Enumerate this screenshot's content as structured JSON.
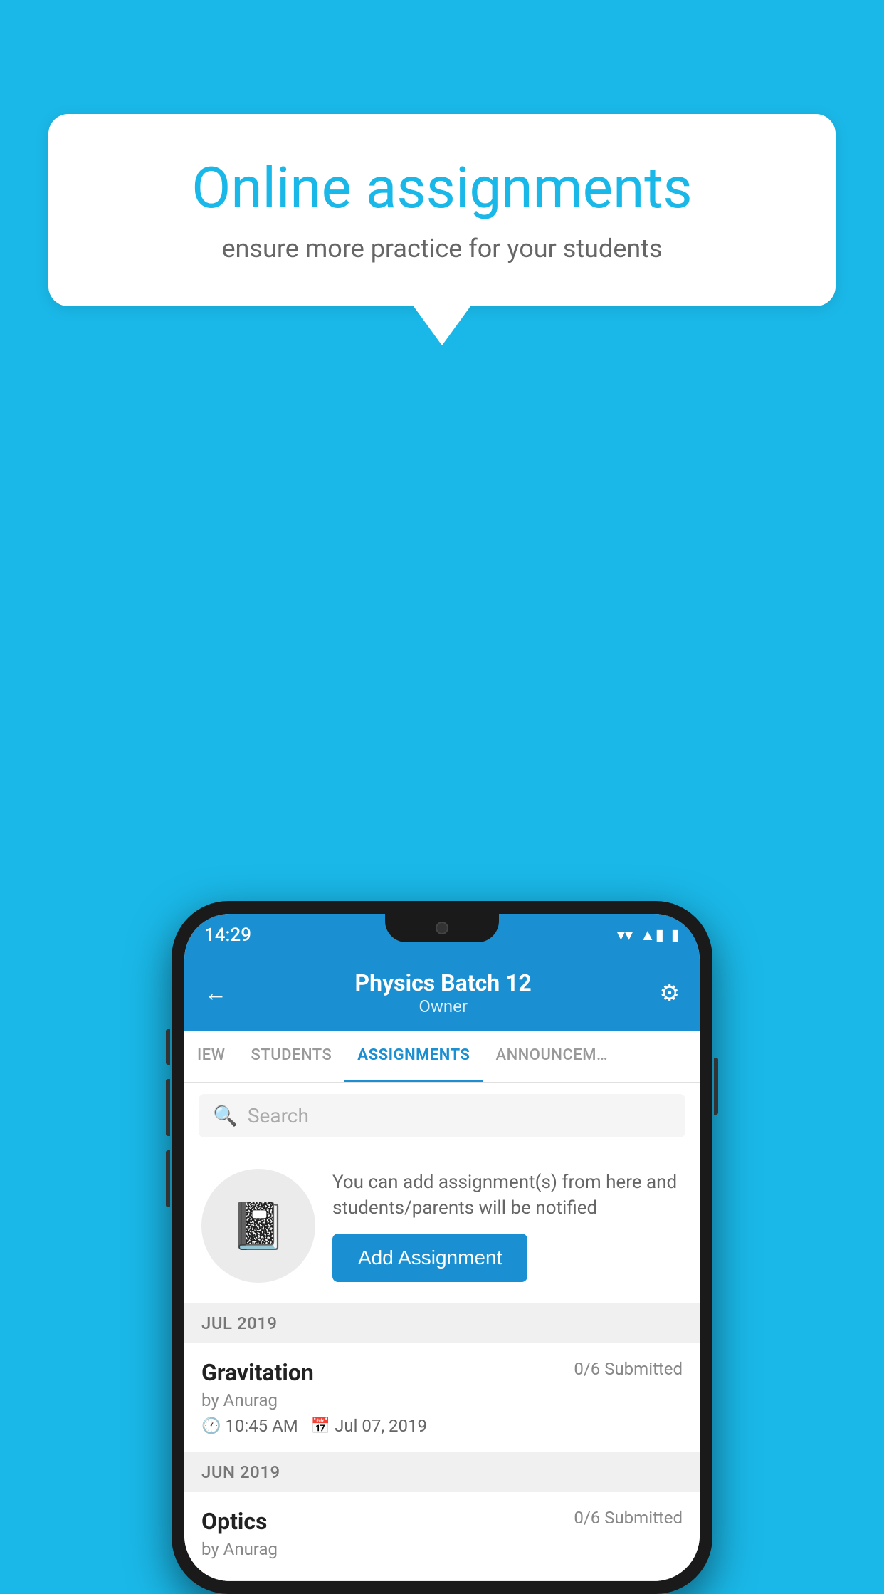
{
  "background_color": "#1ab8e8",
  "speech_bubble": {
    "title": "Online assignments",
    "subtitle": "ensure more practice for your students"
  },
  "status_bar": {
    "time": "14:29",
    "wifi": "▾",
    "signal": "▲",
    "battery": "▮"
  },
  "header": {
    "batch_name": "Physics Batch 12",
    "owner_label": "Owner",
    "back_label": "←",
    "settings_label": "⚙"
  },
  "tabs": [
    {
      "label": "IEW",
      "active": false
    },
    {
      "label": "STUDENTS",
      "active": false
    },
    {
      "label": "ASSIGNMENTS",
      "active": true
    },
    {
      "label": "ANNOUNCEM…",
      "active": false
    }
  ],
  "search": {
    "placeholder": "Search"
  },
  "promo": {
    "description": "You can add assignment(s) from here and students/parents will be notified",
    "button_label": "Add Assignment"
  },
  "sections": [
    {
      "month_label": "JUL 2019",
      "assignments": [
        {
          "title": "Gravitation",
          "submitted": "0/6 Submitted",
          "author": "by Anurag",
          "time": "10:45 AM",
          "date": "Jul 07, 2019"
        }
      ]
    },
    {
      "month_label": "JUN 2019",
      "assignments": [
        {
          "title": "Optics",
          "submitted": "0/6 Submitted",
          "author": "by Anurag",
          "time": "",
          "date": ""
        }
      ]
    }
  ]
}
